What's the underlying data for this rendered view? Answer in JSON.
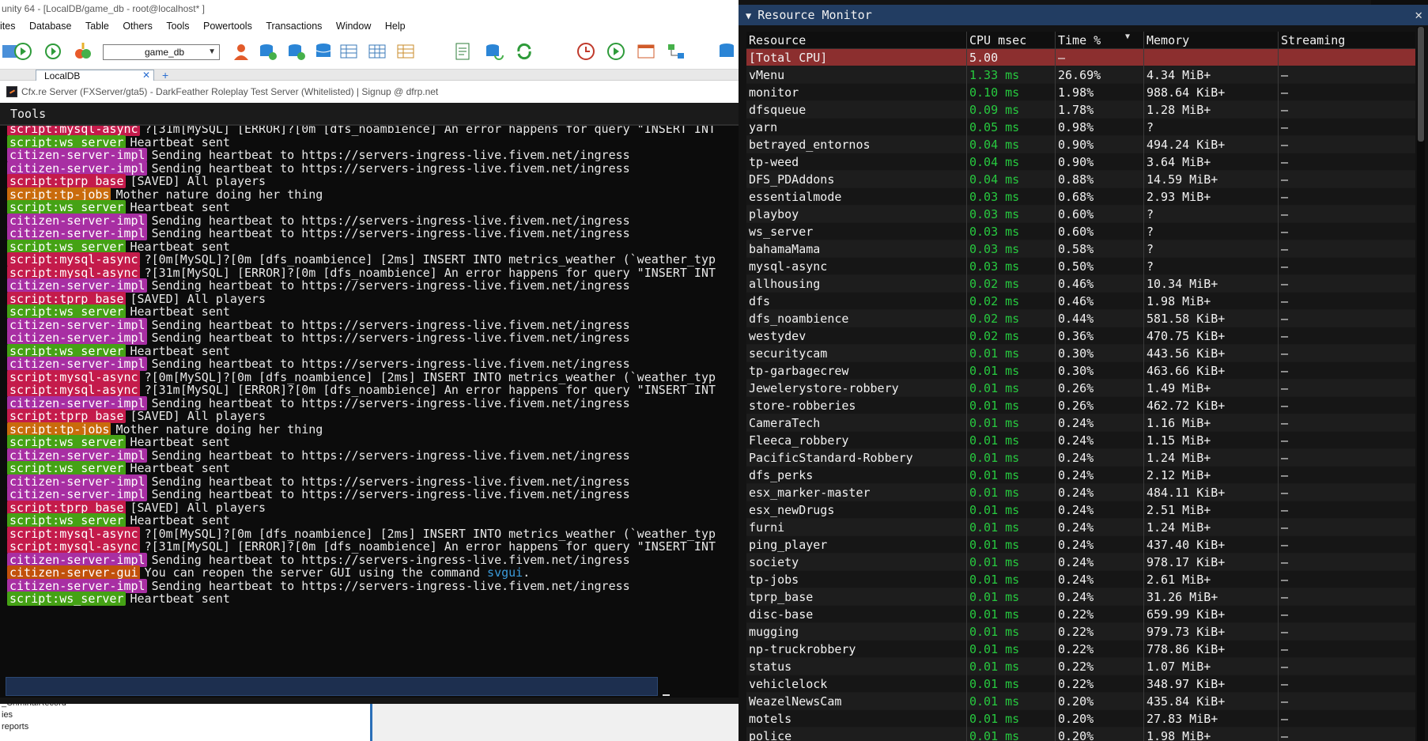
{
  "background_window": {
    "title": "unity 64 - [LocalDB/game_db - root@localhost* ]",
    "menu": [
      "ites",
      "Database",
      "Table",
      "Others",
      "Tools",
      "Powertools",
      "Transactions",
      "Window",
      "Help"
    ],
    "db_select": "game_db",
    "tab_label": "LocalDB",
    "tree_items": [
      "_CriminalRecord",
      "ies",
      "reports"
    ]
  },
  "console": {
    "title": "Cfx.re Server (FXServer/gta5) - DarkFeather Roleplay Test Server (Whitelisted) | Signup @ dfrp.net",
    "tools_label": "Tools",
    "lines": [
      {
        "tag": "script:mysql-async",
        "color": "red",
        "text": "?[31m[MySQL] [ERROR]?[0m [dfs_noambience] An error happens for query \"INSERT INT"
      },
      {
        "tag": "script:ws_server",
        "color": "green",
        "text": "Heartbeat sent"
      },
      {
        "tag": "citizen-server-impl",
        "color": "purple",
        "text": "Sending heartbeat to https://servers-ingress-live.fivem.net/ingress"
      },
      {
        "tag": "citizen-server-impl",
        "color": "purple",
        "text": "Sending heartbeat to https://servers-ingress-live.fivem.net/ingress"
      },
      {
        "tag": "script:tprp_base",
        "color": "red",
        "text": "[SAVED] All players"
      },
      {
        "tag": "script:tp-jobs",
        "color": "orange",
        "text": "Mother nature doing her thing"
      },
      {
        "tag": "script:ws_server",
        "color": "green",
        "text": "Heartbeat sent"
      },
      {
        "tag": "citizen-server-impl",
        "color": "purple",
        "text": "Sending heartbeat to https://servers-ingress-live.fivem.net/ingress"
      },
      {
        "tag": "citizen-server-impl",
        "color": "purple",
        "text": "Sending heartbeat to https://servers-ingress-live.fivem.net/ingress"
      },
      {
        "tag": "script:ws_server",
        "color": "green",
        "text": "Heartbeat sent"
      },
      {
        "tag": "script:mysql-async",
        "color": "red",
        "text": "?[0m[MySQL]?[0m [dfs_noambience] [2ms] INSERT INTO metrics_weather (`weather_typ"
      },
      {
        "tag": "script:mysql-async",
        "color": "red",
        "text": "?[31m[MySQL] [ERROR]?[0m [dfs_noambience] An error happens for query \"INSERT INT"
      },
      {
        "tag": "citizen-server-impl",
        "color": "purple",
        "text": "Sending heartbeat to https://servers-ingress-live.fivem.net/ingress"
      },
      {
        "tag": "script:tprp_base",
        "color": "red",
        "text": "[SAVED] All players"
      },
      {
        "tag": "script:ws_server",
        "color": "green",
        "text": "Heartbeat sent"
      },
      {
        "tag": "citizen-server-impl",
        "color": "purple",
        "text": "Sending heartbeat to https://servers-ingress-live.fivem.net/ingress"
      },
      {
        "tag": "citizen-server-impl",
        "color": "purple",
        "text": "Sending heartbeat to https://servers-ingress-live.fivem.net/ingress"
      },
      {
        "tag": "script:ws_server",
        "color": "green",
        "text": "Heartbeat sent"
      },
      {
        "tag": "citizen-server-impl",
        "color": "purple",
        "text": "Sending heartbeat to https://servers-ingress-live.fivem.net/ingress"
      },
      {
        "tag": "script:mysql-async",
        "color": "red",
        "text": "?[0m[MySQL]?[0m [dfs_noambience] [2ms] INSERT INTO metrics_weather (`weather_typ"
      },
      {
        "tag": "script:mysql-async",
        "color": "red",
        "text": "?[31m[MySQL] [ERROR]?[0m [dfs_noambience] An error happens for query \"INSERT INT"
      },
      {
        "tag": "citizen-server-impl",
        "color": "purple",
        "text": "Sending heartbeat to https://servers-ingress-live.fivem.net/ingress"
      },
      {
        "tag": "script:tprp_base",
        "color": "red",
        "text": "[SAVED] All players"
      },
      {
        "tag": "script:tp-jobs",
        "color": "orange",
        "text": "Mother nature doing her thing"
      },
      {
        "tag": "script:ws_server",
        "color": "green",
        "text": "Heartbeat sent"
      },
      {
        "tag": "citizen-server-impl",
        "color": "purple",
        "text": "Sending heartbeat to https://servers-ingress-live.fivem.net/ingress"
      },
      {
        "tag": "script:ws_server",
        "color": "green",
        "text": "Heartbeat sent"
      },
      {
        "tag": "citizen-server-impl",
        "color": "purple",
        "text": "Sending heartbeat to https://servers-ingress-live.fivem.net/ingress"
      },
      {
        "tag": "citizen-server-impl",
        "color": "purple",
        "text": "Sending heartbeat to https://servers-ingress-live.fivem.net/ingress"
      },
      {
        "tag": "script:tprp_base",
        "color": "red",
        "text": "[SAVED] All players"
      },
      {
        "tag": "script:ws_server",
        "color": "green",
        "text": "Heartbeat sent"
      },
      {
        "tag": "script:mysql-async",
        "color": "red",
        "text": "?[0m[MySQL]?[0m [dfs_noambience] [2ms] INSERT INTO metrics_weather (`weather_typ"
      },
      {
        "tag": "script:mysql-async",
        "color": "red",
        "text": "?[31m[MySQL] [ERROR]?[0m [dfs_noambience] An error happens for query \"INSERT INT"
      },
      {
        "tag": "citizen-server-impl",
        "color": "purple",
        "text": "Sending heartbeat to https://servers-ingress-live.fivem.net/ingress"
      },
      {
        "tag": "citizen-server-gui",
        "color": "brown",
        "text": "You can reopen the server GUI using the command ",
        "highlight": "svgui",
        "after": "."
      },
      {
        "tag": "citizen-server-impl",
        "color": "purple",
        "text": "Sending heartbeat to https://servers-ingress-live.fivem.net/ingress"
      },
      {
        "tag": "script:ws_server",
        "color": "green",
        "text": "Heartbeat sent"
      }
    ]
  },
  "monitor": {
    "title": "Resource Monitor",
    "columns": [
      "Resource",
      "CPU msec",
      "Time %",
      "Memory",
      "Streaming"
    ],
    "total": {
      "name": "[Total CPU]",
      "cpu": "5.00",
      "time": "–",
      "mem": "",
      "stream": ""
    },
    "rows": [
      [
        "vMenu",
        "1.33 ms",
        "26.69%",
        "4.34 MiB+",
        "–"
      ],
      [
        "monitor",
        "0.10 ms",
        "1.98%",
        "988.64 KiB+",
        "–"
      ],
      [
        "dfsqueue",
        "0.09 ms",
        "1.78%",
        "1.28 MiB+",
        "–"
      ],
      [
        "yarn",
        "0.05 ms",
        "0.98%",
        "?",
        "–"
      ],
      [
        "betrayed_entornos",
        "0.04 ms",
        "0.90%",
        "494.24 KiB+",
        "–"
      ],
      [
        "tp-weed",
        "0.04 ms",
        "0.90%",
        "3.64 MiB+",
        "–"
      ],
      [
        "DFS_PDAddons",
        "0.04 ms",
        "0.88%",
        "14.59 MiB+",
        "–"
      ],
      [
        "essentialmode",
        "0.03 ms",
        "0.68%",
        "2.93 MiB+",
        "–"
      ],
      [
        "playboy",
        "0.03 ms",
        "0.60%",
        "?",
        "–"
      ],
      [
        "ws_server",
        "0.03 ms",
        "0.60%",
        "?",
        "–"
      ],
      [
        "bahamaMama",
        "0.03 ms",
        "0.58%",
        "?",
        "–"
      ],
      [
        "mysql-async",
        "0.03 ms",
        "0.50%",
        "?",
        "–"
      ],
      [
        "allhousing",
        "0.02 ms",
        "0.46%",
        "10.34 MiB+",
        "–"
      ],
      [
        "dfs",
        "0.02 ms",
        "0.46%",
        "1.98 MiB+",
        "–"
      ],
      [
        "dfs_noambience",
        "0.02 ms",
        "0.44%",
        "581.58 KiB+",
        "–"
      ],
      [
        "westydev",
        "0.02 ms",
        "0.36%",
        "470.75 KiB+",
        "–"
      ],
      [
        "securitycam",
        "0.01 ms",
        "0.30%",
        "443.56 KiB+",
        "–"
      ],
      [
        "tp-garbagecrew",
        "0.01 ms",
        "0.30%",
        "463.66 KiB+",
        "–"
      ],
      [
        "Jewelerystore-robbery",
        "0.01 ms",
        "0.26%",
        "1.49 MiB+",
        "–"
      ],
      [
        "store-robberies",
        "0.01 ms",
        "0.26%",
        "462.72 KiB+",
        "–"
      ],
      [
        "CameraTech",
        "0.01 ms",
        "0.24%",
        "1.16 MiB+",
        "–"
      ],
      [
        "Fleeca_robbery",
        "0.01 ms",
        "0.24%",
        "1.15 MiB+",
        "–"
      ],
      [
        "PacificStandard-Robbery",
        "0.01 ms",
        "0.24%",
        "1.24 MiB+",
        "–"
      ],
      [
        "dfs_perks",
        "0.01 ms",
        "0.24%",
        "2.12 MiB+",
        "–"
      ],
      [
        "esx_marker-master",
        "0.01 ms",
        "0.24%",
        "484.11 KiB+",
        "–"
      ],
      [
        "esx_newDrugs",
        "0.01 ms",
        "0.24%",
        "2.51 MiB+",
        "–"
      ],
      [
        "furni",
        "0.01 ms",
        "0.24%",
        "1.24 MiB+",
        "–"
      ],
      [
        "ping_player",
        "0.01 ms",
        "0.24%",
        "437.40 KiB+",
        "–"
      ],
      [
        "society",
        "0.01 ms",
        "0.24%",
        "978.17 KiB+",
        "–"
      ],
      [
        "tp-jobs",
        "0.01 ms",
        "0.24%",
        "2.61 MiB+",
        "–"
      ],
      [
        "tprp_base",
        "0.01 ms",
        "0.24%",
        "31.26 MiB+",
        "–"
      ],
      [
        "disc-base",
        "0.01 ms",
        "0.22%",
        "659.99 KiB+",
        "–"
      ],
      [
        "mugging",
        "0.01 ms",
        "0.22%",
        "979.73 KiB+",
        "–"
      ],
      [
        "np-truckrobbery",
        "0.01 ms",
        "0.22%",
        "778.86 KiB+",
        "–"
      ],
      [
        "status",
        "0.01 ms",
        "0.22%",
        "1.07 MiB+",
        "–"
      ],
      [
        "vehiclelock",
        "0.01 ms",
        "0.22%",
        "348.97 KiB+",
        "–"
      ],
      [
        "WeazelNewsCam",
        "0.01 ms",
        "0.20%",
        "435.84 KiB+",
        "–"
      ],
      [
        "motels",
        "0.01 ms",
        "0.20%",
        "27.83 MiB+",
        "–"
      ],
      [
        "police",
        "0.01 ms",
        "0.20%",
        "1.98 MiB+",
        "–"
      ]
    ]
  }
}
